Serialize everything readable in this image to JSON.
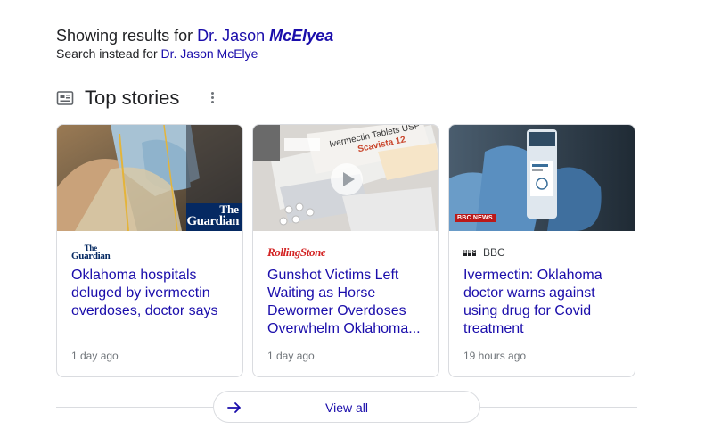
{
  "spelling": {
    "showing_prefix": "Showing results for",
    "corrected_first": "Dr. Jason",
    "corrected_emph": "McElyea",
    "instead_prefix": "Search instead for",
    "original_query": "Dr. Jason McElye"
  },
  "top_stories": {
    "title": "Top stories",
    "icons": {
      "section": "newspaper-icon",
      "menu": "more-vert-icon",
      "play": "play-icon",
      "arrow": "arrow-right-icon"
    },
    "cards": [
      {
        "source_logo_text_1": "The",
        "source_logo_text_2": "Guardian",
        "thumb_logo_1": "The",
        "thumb_logo_2": "Guardian",
        "headline": "Oklahoma hospitals deluged by ivermectin overdoses, doctor says",
        "age": "1 day ago"
      },
      {
        "source_logo_text": "RollingStone",
        "headline": "Gunshot Victims Left Waiting as Horse Dewormer Overdoses Overwhelm Oklahoma...",
        "age": "1 day ago",
        "thumb_text_1": "Ivermectin Tablets USP",
        "thumb_text_2": "Scavista 12",
        "has_video": true
      },
      {
        "source_name": "BBC",
        "thumb_badge": "BBC NEWS",
        "headline": "Ivermectin: Oklahoma doctor warns against using drug for Covid treatment",
        "age": "19 hours ago"
      }
    ],
    "view_all": "View all"
  },
  "colors": {
    "link": "#1a0dab",
    "text": "#202124",
    "muted": "#70757a",
    "border": "#dadce0",
    "guardian_blue": "#052962",
    "rolling_stone_red": "#d32323",
    "bbc_red": "#bb1919"
  }
}
